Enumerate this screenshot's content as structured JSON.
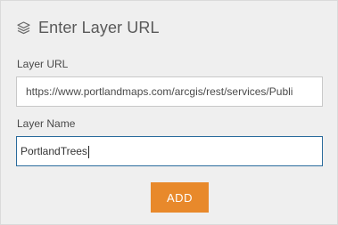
{
  "header": {
    "title": "Enter Layer URL",
    "icon": "layers-icon"
  },
  "form": {
    "url_label": "Layer URL",
    "url_value": "https://www.portlandmaps.com/arcgis/rest/services/Publi",
    "name_label": "Layer Name",
    "name_value": "PortlandTrees"
  },
  "actions": {
    "add_label": "ADD"
  },
  "colors": {
    "panel_background": "#efefef",
    "add_button": "#e8892b",
    "focus_border": "#2a6b9c"
  }
}
